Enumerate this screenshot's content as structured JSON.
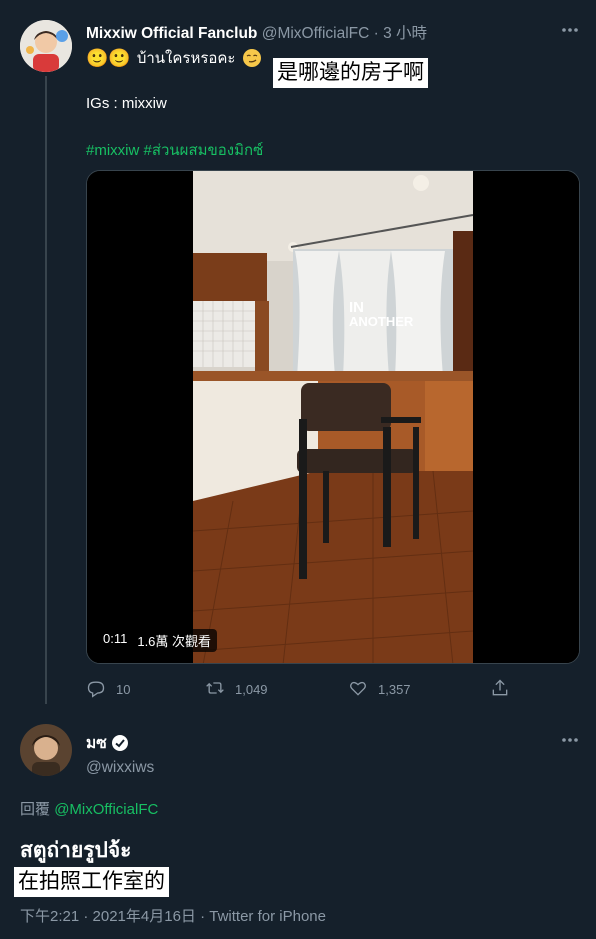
{
  "tweet": {
    "display_name": "Mixxiw Official Fanclub",
    "handle": "@MixOfficialFC",
    "separator": "·",
    "time": "3 小時",
    "emoji_text": "🙂🙂",
    "thai_text": "บ้านใครหรอคะ",
    "overlay_translation": "是哪邊的房子啊",
    "igs_line": "IGs : mixxiw",
    "hashtags": "#mixxiw #ส่วนผสมของมิกซ์",
    "video": {
      "watermark_top": "IN",
      "watermark_bottom": "ANOTHER",
      "duration": "0:11",
      "views": "1.6萬 次觀看"
    },
    "actions": {
      "reply_count": "10",
      "retweet_count": "1,049",
      "like_count": "1,357"
    }
  },
  "reply": {
    "display_name": "มซ",
    "handle": "@wixxiws",
    "replying_to_label": "回覆",
    "replying_to_handle": "@MixOfficialFC",
    "text": "สตูถ่ายรูปจ้ะ",
    "overlay_translation": "在拍照工作室的",
    "meta": "下午2:21 · 2021年4月16日 · Twitter for iPhone"
  },
  "icons": [
    "more-icon",
    "reply-icon",
    "retweet-icon",
    "like-icon",
    "share-icon",
    "verified-icon"
  ]
}
